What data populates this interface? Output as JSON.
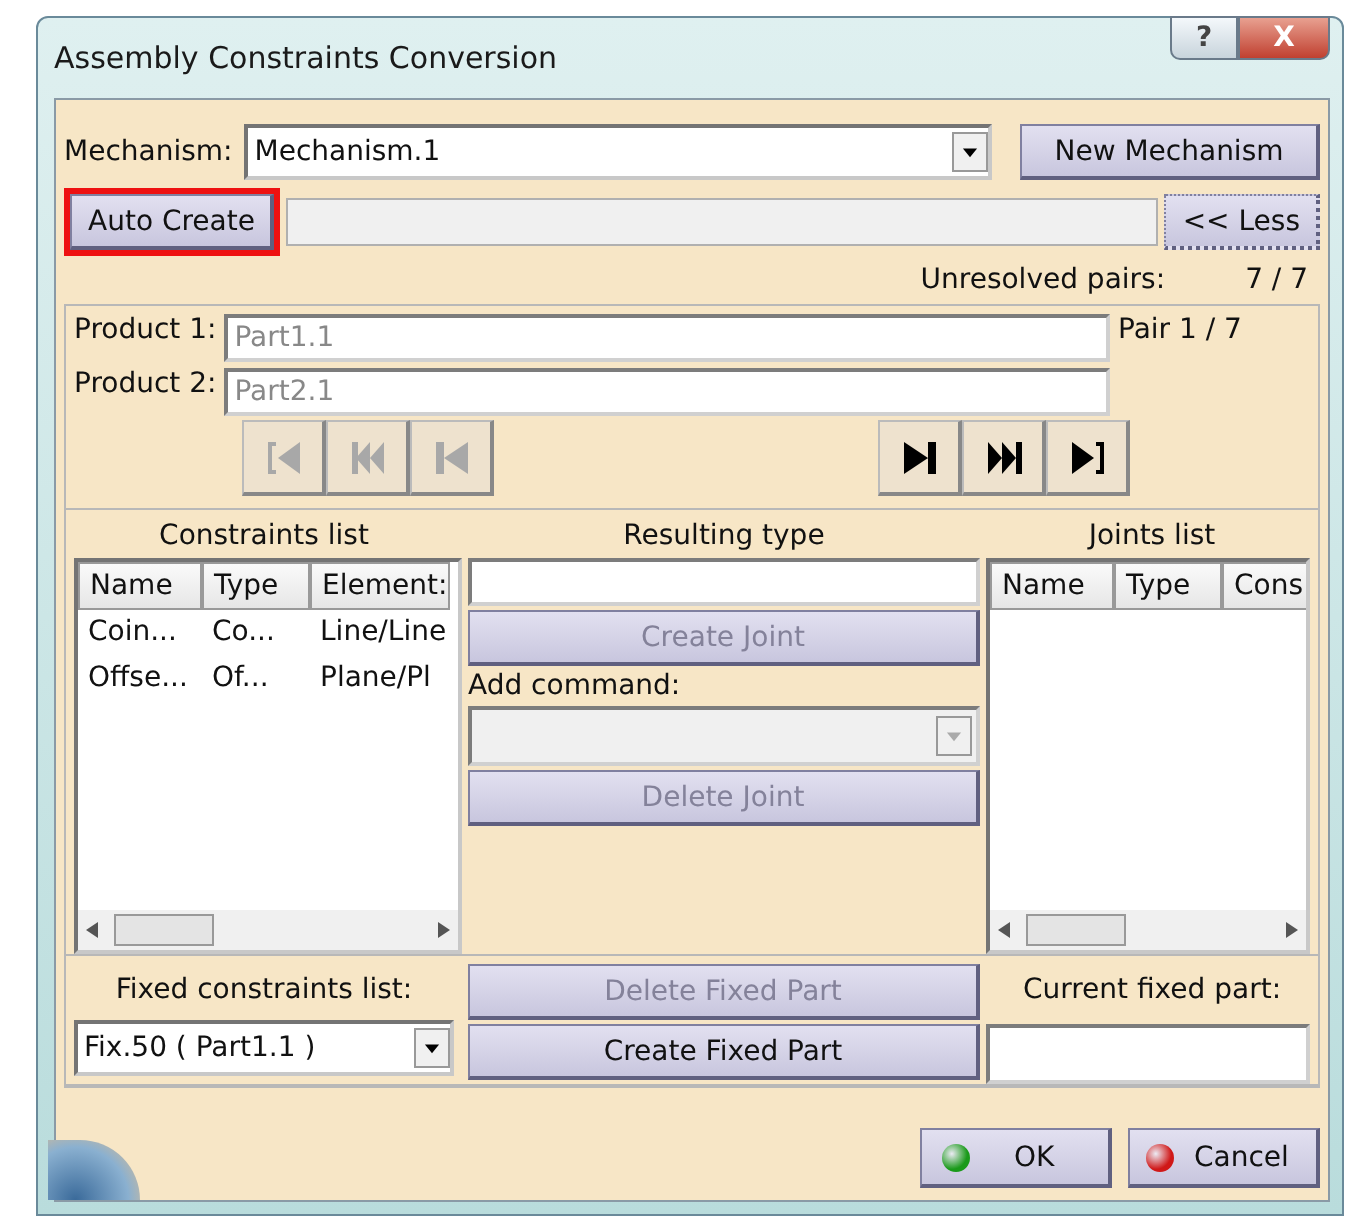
{
  "window": {
    "title": "Assembly Constraints Conversion",
    "controls": [
      "?",
      "X"
    ]
  },
  "mechanism": {
    "label": "Mechanism:",
    "value": "Mechanism.1",
    "button": "New Mechanism"
  },
  "auto_create": {
    "label": "Auto Create",
    "highlighted": true
  },
  "progress": {
    "level": 0
  },
  "less_button": "<< Less",
  "unresolved": {
    "label": "Unresolved pairs:",
    "value": "7 / 7"
  },
  "products": [
    {
      "label": "Product 1:",
      "value": "Part1.1"
    },
    {
      "label": "Product 2:",
      "value": "Part2.1"
    }
  ],
  "pair": "Pair 1 / 7",
  "nav_buttons": [
    {
      "kind": "first",
      "disabled": true
    },
    {
      "kind": "fast-back",
      "disabled": true
    },
    {
      "kind": "back",
      "disabled": true
    },
    {
      "kind": "forward",
      "disabled": false
    },
    {
      "kind": "fast-forward",
      "disabled": false
    },
    {
      "kind": "last",
      "disabled": false
    }
  ],
  "constraints_list": {
    "title": "Constraints list",
    "columns": [
      "Name",
      "Type",
      "Element:"
    ],
    "rows": [
      [
        "Coin...",
        "Co...",
        "Line/Line"
      ],
      [
        "Offse...",
        "Of...",
        "Plane/Pl"
      ]
    ]
  },
  "resulting_type": {
    "title": "Resulting type",
    "create_joint": {
      "label": "Create Joint",
      "disabled": true
    },
    "add_command_label": "Add command:",
    "delete_joint": {
      "label": "Delete Joint",
      "disabled": true
    }
  },
  "joints_list": {
    "title": "Joints list",
    "columns": [
      "Name",
      "Type",
      "Cons"
    ]
  },
  "fixed": {
    "list_label": "Fixed constraints list:",
    "value": "Fix.50 ( Part1.1 )",
    "delete_button": {
      "label": "Delete Fixed Part",
      "disabled": true
    },
    "create_button": {
      "label": "Create Fixed Part",
      "disabled": false
    },
    "current_label": "Current fixed part:"
  },
  "footer": [
    {
      "kind": "ok",
      "label": "OK"
    },
    {
      "kind": "cancel",
      "label": "Cancel"
    }
  ]
}
